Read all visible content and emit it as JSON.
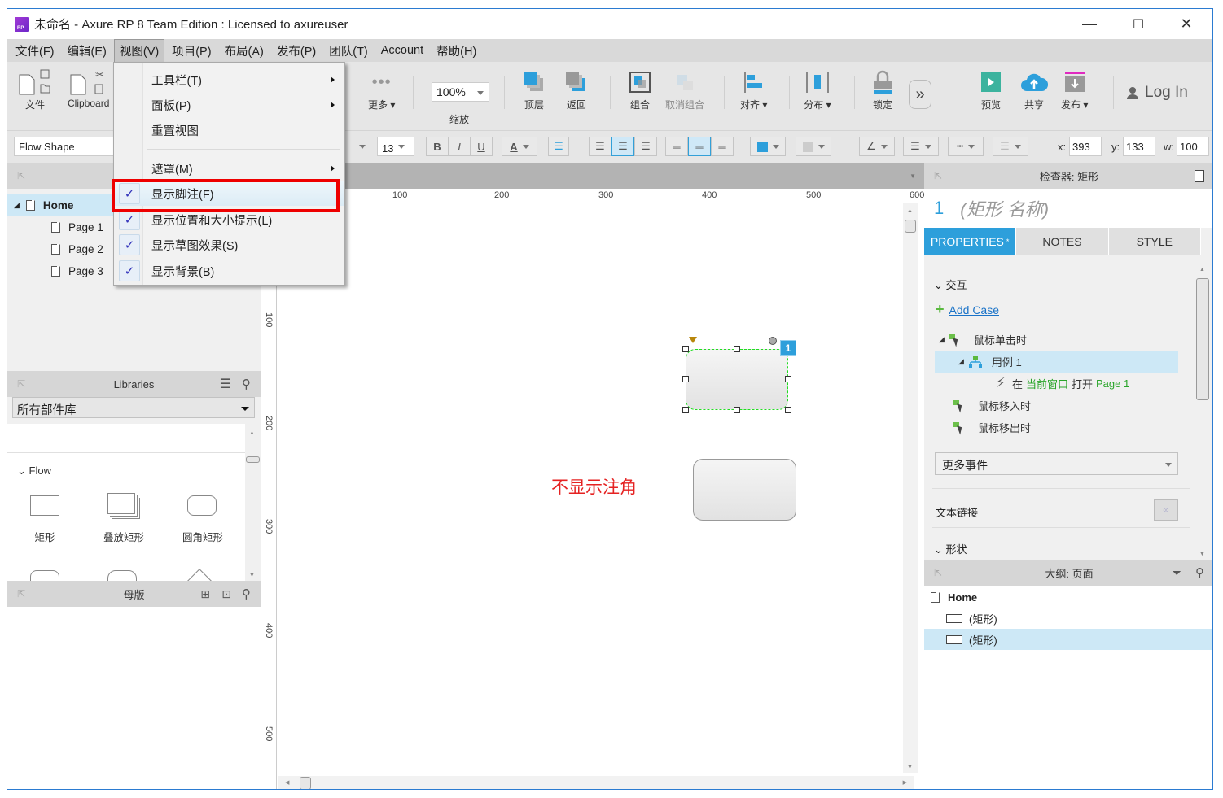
{
  "window": {
    "title": "未命名 - Axure RP 8 Team Edition : Licensed to axureuser",
    "logo_text": "RP",
    "controls": {
      "minimize": "—",
      "maximize": "☐",
      "close": "✕"
    }
  },
  "menubar": {
    "items": [
      {
        "label": "文件(F)"
      },
      {
        "label": "编辑(E)"
      },
      {
        "label": "视图(V)",
        "active": true
      },
      {
        "label": "项目(P)"
      },
      {
        "label": "布局(A)"
      },
      {
        "label": "发布(P)"
      },
      {
        "label": "团队(T)"
      },
      {
        "label": "Account"
      },
      {
        "label": "帮助(H)"
      }
    ]
  },
  "toolbar": {
    "file_label": "文件",
    "clipboard_label": "Clipboard",
    "more_label": "更多 ▾",
    "zoom_value": "100%",
    "zoom_label": "缩放",
    "top_label": "顶层",
    "back_label": "返回",
    "group_label": "组合",
    "ungroup_label": "取消组合",
    "align_label": "对齐 ▾",
    "distribute_label": "分布 ▾",
    "lock_label": "锁定",
    "overflow_icon": "»",
    "preview_label": "预览",
    "share_label": "共享",
    "publish_label": "发布 ▾",
    "login_label": "Log In"
  },
  "format_bar": {
    "style_select": "Flow Shape",
    "font_size": "13",
    "bold": "B",
    "italic": "I",
    "underline": "U",
    "font_color": "A",
    "x_label": "x:",
    "x_value": "393",
    "y_label": "y:",
    "y_value": "133",
    "w_label": "w:",
    "w_value": "100"
  },
  "view_menu": {
    "items": [
      {
        "label": "工具栏(T)",
        "submenu": true
      },
      {
        "label": "面板(P)",
        "submenu": true
      },
      {
        "label": "重置视图"
      },
      {
        "label": "遮罩(M)",
        "submenu": true
      },
      {
        "label": "显示脚注(F)",
        "checked": true,
        "highlighted": true
      },
      {
        "label": "显示位置和大小提示(L)",
        "checked": true
      },
      {
        "label": "显示草图效果(S)",
        "checked": true
      },
      {
        "label": "显示背景(B)",
        "checked": true
      }
    ],
    "check_glyph": "✓"
  },
  "pages_panel": {
    "pages": [
      {
        "label": "Home",
        "level": 0,
        "selected": true
      },
      {
        "label": "Page 1",
        "level": 1
      },
      {
        "label": "Page 2",
        "level": 1
      },
      {
        "label": "Page 3",
        "level": 1
      }
    ]
  },
  "libraries_panel": {
    "title": "Libraries",
    "library_select": "所有部件库",
    "group_label": "Flow",
    "shapes": [
      {
        "label": "矩形"
      },
      {
        "label": "叠放矩形"
      },
      {
        "label": "圆角矩形"
      }
    ]
  },
  "masters_panel": {
    "title": "母版"
  },
  "canvas": {
    "ruler_h": [
      "100",
      "200",
      "300",
      "400",
      "500",
      "600"
    ],
    "ruler_v": [
      "100",
      "200",
      "300",
      "400",
      "500"
    ],
    "annotation_text": "不显示注角",
    "footnote_badge": "1",
    "colors": {
      "selection": "#22dd22",
      "badge": "#2d9fdb",
      "annotation": "#e52222"
    }
  },
  "inspector": {
    "title": "检查器: 矩形",
    "widget_number": "1",
    "widget_name_placeholder": "(矩形 名称)",
    "tabs": [
      {
        "label": "PROPERTIES",
        "active": true,
        "mark": "*"
      },
      {
        "label": "NOTES"
      },
      {
        "label": "STYLE"
      }
    ],
    "interaction_section": "交互",
    "add_case": "Add Case",
    "events": [
      {
        "label": "鼠标单击时"
      },
      {
        "label": "用例 1"
      },
      {
        "action_prefix": "在",
        "action_target": "当前窗口",
        "action_verb": "打开",
        "action_page": "Page 1"
      },
      {
        "label": "鼠标移入时"
      },
      {
        "label": "鼠标移出时"
      }
    ],
    "more_events": "更多事件",
    "text_link": "文本链接",
    "shape_section": "形状",
    "accent_color": "#2d9fdb",
    "link_color": "#2aa52a"
  },
  "outline_panel": {
    "title": "大纲: 页面",
    "items": [
      {
        "label": "Home"
      },
      {
        "label": "(矩形)"
      },
      {
        "label": "(矩形)",
        "selected": true
      }
    ]
  }
}
